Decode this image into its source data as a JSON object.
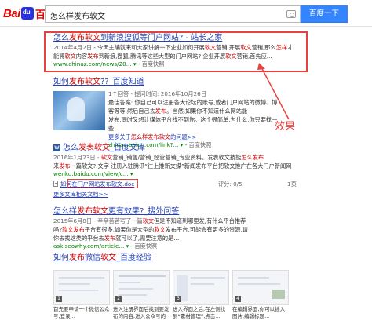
{
  "header": {
    "logo_bai": "Bai",
    "logo_zh": "百度",
    "search_value": "怎么样发布软文",
    "search_button": "百度一下"
  },
  "results": [
    {
      "title_a": "怎么",
      "title_b": "发布软文",
      "title_c": "到新浪搜狐等门户网站? - 站长之家",
      "abs1_date": "2014年4月2日",
      "abs1_text": " - 今天主编就来和大家讲解一下企业如何开展",
      "abs1_hl1": "软文",
      "abs1_text2": "营销,开展",
      "abs1_hl2": "软文",
      "abs1_text3": "营销,那么",
      "abs1_hl3": "怎样",
      "abs1_text4": "才",
      "abs2_a": "能将",
      "abs2_hl1": "软文",
      "abs2_b": "内容",
      "abs2_hl2": "发布",
      "abs2_c": "到新浪,搜狐,腾讯等这些大型的门户网站? 企业开展",
      "abs2_hl3": "软文",
      "abs2_d": "营销,首先应...",
      "url": "www.chinaz.com/news/20...",
      "snap": "百度快照"
    },
    {
      "title_a": "如何",
      "title_b": "发布软文",
      "title_c": "??_百度知道",
      "meta_1": "1个回答 - 提问时间: 2016年10月26日",
      "meta_2": "最佳答案: 你自己可以注册各大论坛的账号,或者门户网站的微博、博",
      "meta_3": "客等等,然后自己去",
      "meta_3_hl": "发布",
      "meta_3b": "。当然,如果你不知道什么网站能",
      "meta_4": "发布,同时又想让媒体平台找不到你。这个很简单,为什么,你只要找一些",
      "meta_5": "更多关于",
      "meta_5_hl": "怎么样发布软文",
      "meta_5b": "的问题>>",
      "url": "zhidao.baidu.com/link?...",
      "snap": "百度快照"
    },
    {
      "title_a": "怎么",
      "title_b": "发表软文",
      "title_c": "_百度文库",
      "abs1": "2016年1月23日 - ",
      "abs1_hl": "软文",
      "abs1_b": "营销_销售/营销_经管营销_专业资料。发表软文技能",
      "abs1_hl2": "怎么",
      "abs1_c": "发布",
      "abs2": "来",
      "abs2_hl": "发布",
      "abs2_b": "一篇软文? 文字 注册入驻腾讯“往上推新文媒”新闻发布平台把软文推广在各大门户新闻网",
      "url": "wenku.baidu.com/view/c...",
      "doc_title": "如何在门户网站发布软文.doc",
      "doc_score": "评分: 0/5",
      "doc_pages": "1页",
      "more": "更多文库相关文档>>"
    },
    {
      "title_a": "怎么样",
      "title_b": "发布软文",
      "title_c": "更有效果?_搜外问答",
      "abs1": "2015年6月8日 - 辛辛苦苦写了一篇",
      "abs1_hl": "软文",
      "abs1_b": "但是不知道到哪里发,有什么平台推荐",
      "abs2": "吗?",
      "abs2_hl": "软文发布",
      "abs2_b": "平台有很多,如果你是大型的",
      "abs2_hl2": "软文",
      "abs2_c": "发布平台,可能会有更多的资源,请",
      "abs3": "你去找这类的平台去",
      "abs3_hl": "发布",
      "abs3_b": "就可以了,需要注意的是...",
      "url": "ask.seowhy.com/article...",
      "snap": "百度快照"
    },
    {
      "title_a": "如何",
      "title_b": "发布",
      "title_c": "微信",
      "title_d": "软文",
      "title_e": "_百度经验",
      "steps": [
        {
          "num": "1",
          "text": "首先要申请一个微信公众号,登录..."
        },
        {
          "num": "2",
          "text": "进入注册界面后找到要发布的内容,进入公众号的界面"
        },
        {
          "num": "3",
          "text": "进入界面之后,在左侧找到“素材管理”,点击..."
        },
        {
          "num": "4",
          "text": "在编辑界面,你可以插入图片,编辑标题..."
        }
      ]
    }
  ],
  "annotation": {
    "effect_label": "效果",
    "color": "#e8423f"
  }
}
